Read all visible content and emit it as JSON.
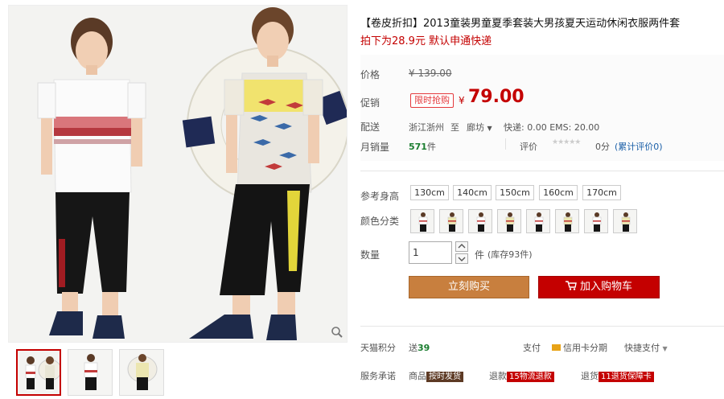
{
  "product": {
    "title": "【卷皮折扣】2013童装男童夏季套装大男孩夏天运动休闲衣服两件套",
    "subtitle": "拍下为28.9元 默认申通快递"
  },
  "pricing": {
    "list_label": "价格",
    "list_currency": "¥",
    "list_price": "139.00",
    "promo_label": "促销",
    "promo_badge": "限时抢购",
    "promo_currency": "¥",
    "promo_price": "79.00"
  },
  "shipping": {
    "label": "配送",
    "from": "浙江浙州",
    "to_word": "至",
    "destination": "廊坊",
    "fees": "快递: 0.00 EMS: 20.00"
  },
  "sales": {
    "label": "月销量",
    "count": "571",
    "unit": "件",
    "rating_label": "评价",
    "rating_score": "0分",
    "rating_link": "(累计评价0)"
  },
  "options": {
    "size_label": "参考身高",
    "sizes": [
      "130cm",
      "140cm",
      "150cm",
      "160cm",
      "170cm"
    ],
    "color_label": "颜色分类",
    "color_count": 8
  },
  "quantity": {
    "label": "数量",
    "value": "1",
    "unit": "件",
    "stock": "(库存93件)"
  },
  "actions": {
    "buy_now": "立刻购买",
    "add_to_cart": "加入购物车"
  },
  "extras": {
    "points_label": "天猫积分",
    "points_prefix": "送",
    "points_value": "39",
    "pay_label": "支付",
    "credit_installment": "信用卡分期",
    "quick_pay": "快捷支付",
    "service_label": "服务承诺",
    "service_1_prefix": "商品",
    "service_1_tag": "按时发货",
    "service_2_prefix": "退款",
    "service_2_tag": "15物流退款",
    "service_3_prefix": "退货",
    "service_3_tag": "11退货保障卡"
  },
  "colors": {
    "accent_red": "#c40000",
    "buy_orange": "#c87f3e",
    "link_green": "#1a7d2f"
  }
}
